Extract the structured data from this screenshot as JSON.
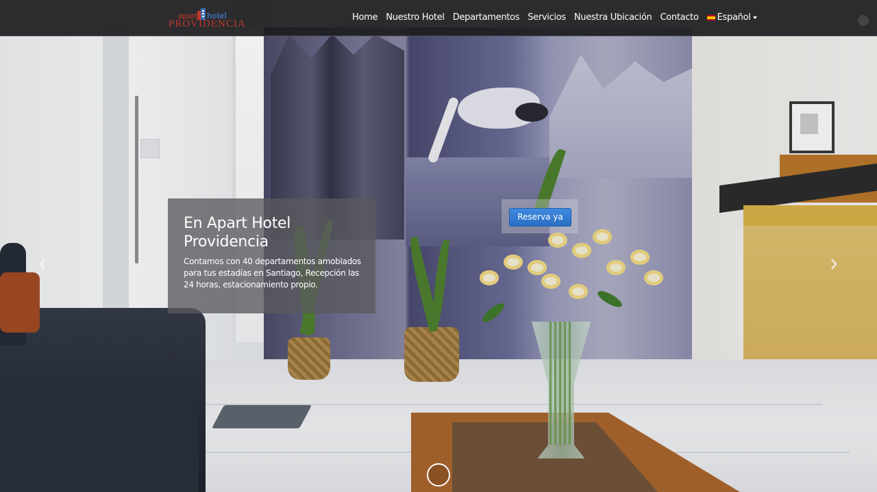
{
  "brand": {
    "small_left": "apart",
    "small_right": "hotel",
    "name": "PROVIDENCIA",
    "colors": {
      "red": "#c0392b",
      "blue": "#3d6fb5"
    }
  },
  "nav": {
    "items": [
      "Home",
      "Nuestro Hotel",
      "Departamentos",
      "Servicios",
      "Nuestra Ubicación",
      "Contacto"
    ],
    "language": {
      "label": "Español",
      "flag": "spain-flag-icon"
    }
  },
  "slide": {
    "title": "En Apart Hotel Providencia",
    "text": "Contamos con 40 departamentos amoblados para tus estadías en Santiago, Recepción las 24 horas, estacionamiento propio.",
    "cta": "Reserva ya",
    "cta_color": "#2a6fc4"
  },
  "carousel": {
    "prev_icon": "chevron-left-icon",
    "next_icon": "chevron-right-icon",
    "indicator_icon": "slide-indicator-circle"
  }
}
